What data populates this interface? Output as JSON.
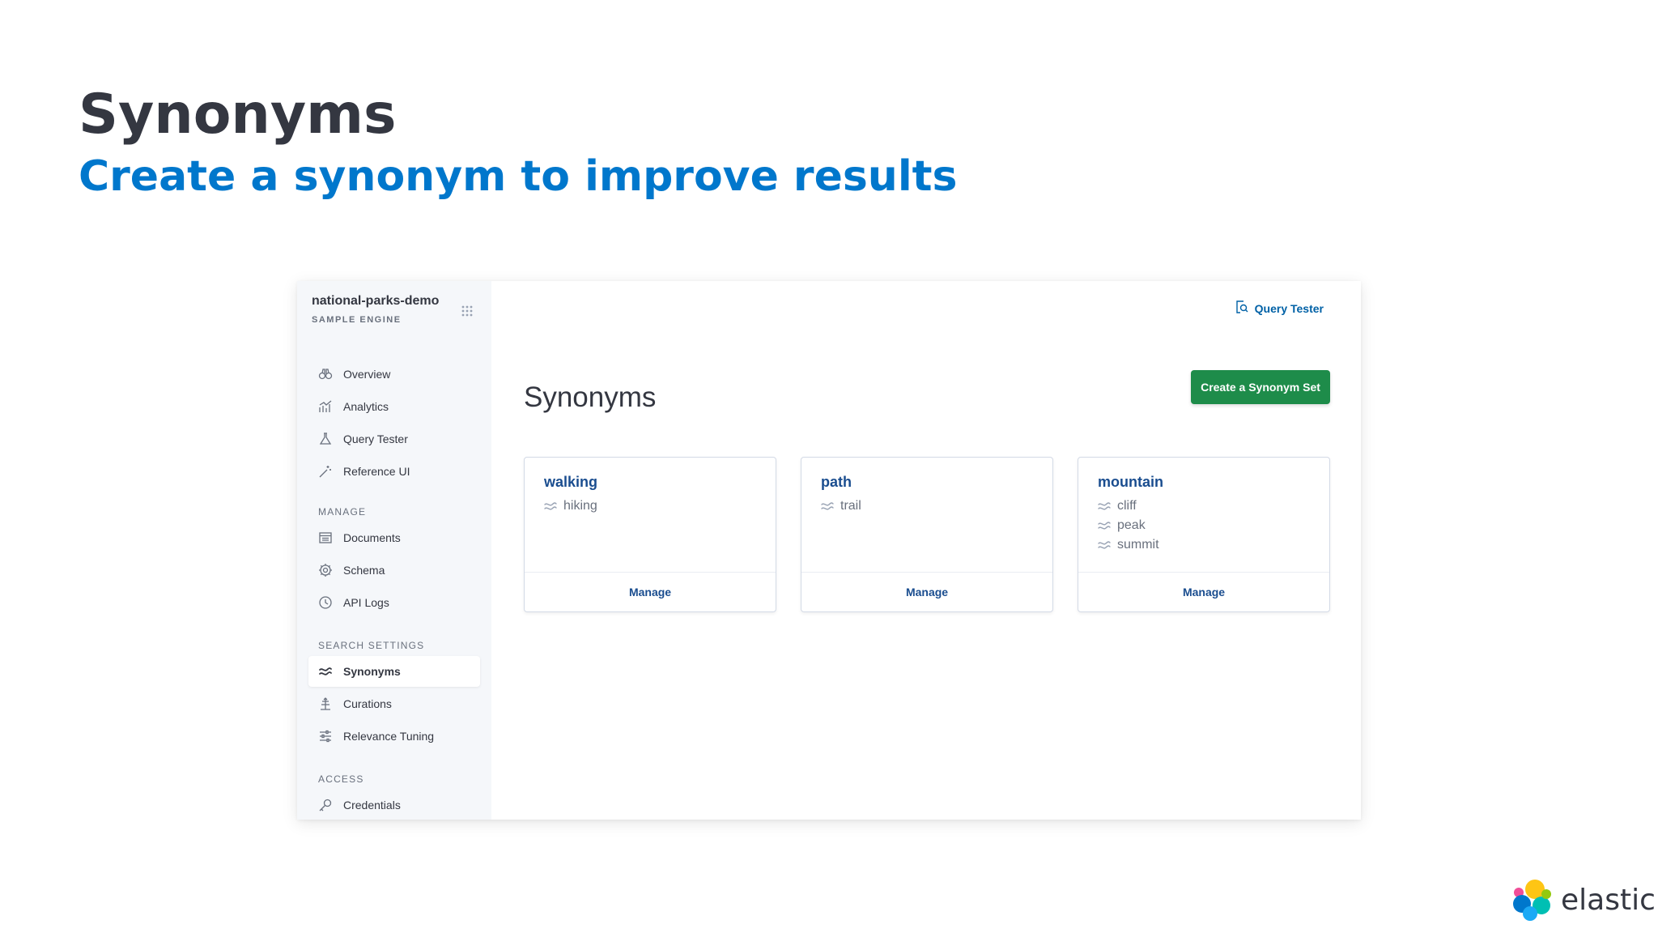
{
  "slide": {
    "title": "Synonyms",
    "subtitle": "Create a synonym to improve results"
  },
  "sidebar": {
    "engine_name": "national-parks-demo",
    "engine_type": "SAMPLE ENGINE",
    "items": [
      {
        "label": "Overview",
        "icon": "binoculars-icon"
      },
      {
        "label": "Analytics",
        "icon": "chart-icon"
      },
      {
        "label": "Query Tester",
        "icon": "flask-icon"
      },
      {
        "label": "Reference UI",
        "icon": "magic-wand-icon"
      }
    ],
    "sections": [
      {
        "label": "MANAGE",
        "items": [
          {
            "label": "Documents",
            "icon": "documents-icon"
          },
          {
            "label": "Schema",
            "icon": "gear-icon"
          },
          {
            "label": "API Logs",
            "icon": "clock-icon"
          }
        ]
      },
      {
        "label": "SEARCH SETTINGS",
        "items": [
          {
            "label": "Synonyms",
            "icon": "approx-icon",
            "active": true
          },
          {
            "label": "Curations",
            "icon": "curations-icon"
          },
          {
            "label": "Relevance Tuning",
            "icon": "sliders-icon"
          }
        ]
      },
      {
        "label": "ACCESS",
        "items": [
          {
            "label": "Credentials",
            "icon": "key-icon"
          }
        ]
      }
    ]
  },
  "header": {
    "query_tester_label": "Query Tester"
  },
  "main": {
    "title": "Synonyms",
    "create_button": "Create a Synonym Set",
    "manage_label": "Manage",
    "cards": [
      {
        "title": "walking",
        "synonyms": [
          "hiking"
        ]
      },
      {
        "title": "path",
        "synonyms": [
          "trail"
        ]
      },
      {
        "title": "mountain",
        "synonyms": [
          "cliff",
          "peak",
          "summit"
        ]
      }
    ]
  },
  "logo": {
    "text": "elastic"
  },
  "colors": {
    "accent_blue": "#0077cc",
    "link_blue": "#1a4d8f",
    "button_green": "#1e8c4a"
  }
}
